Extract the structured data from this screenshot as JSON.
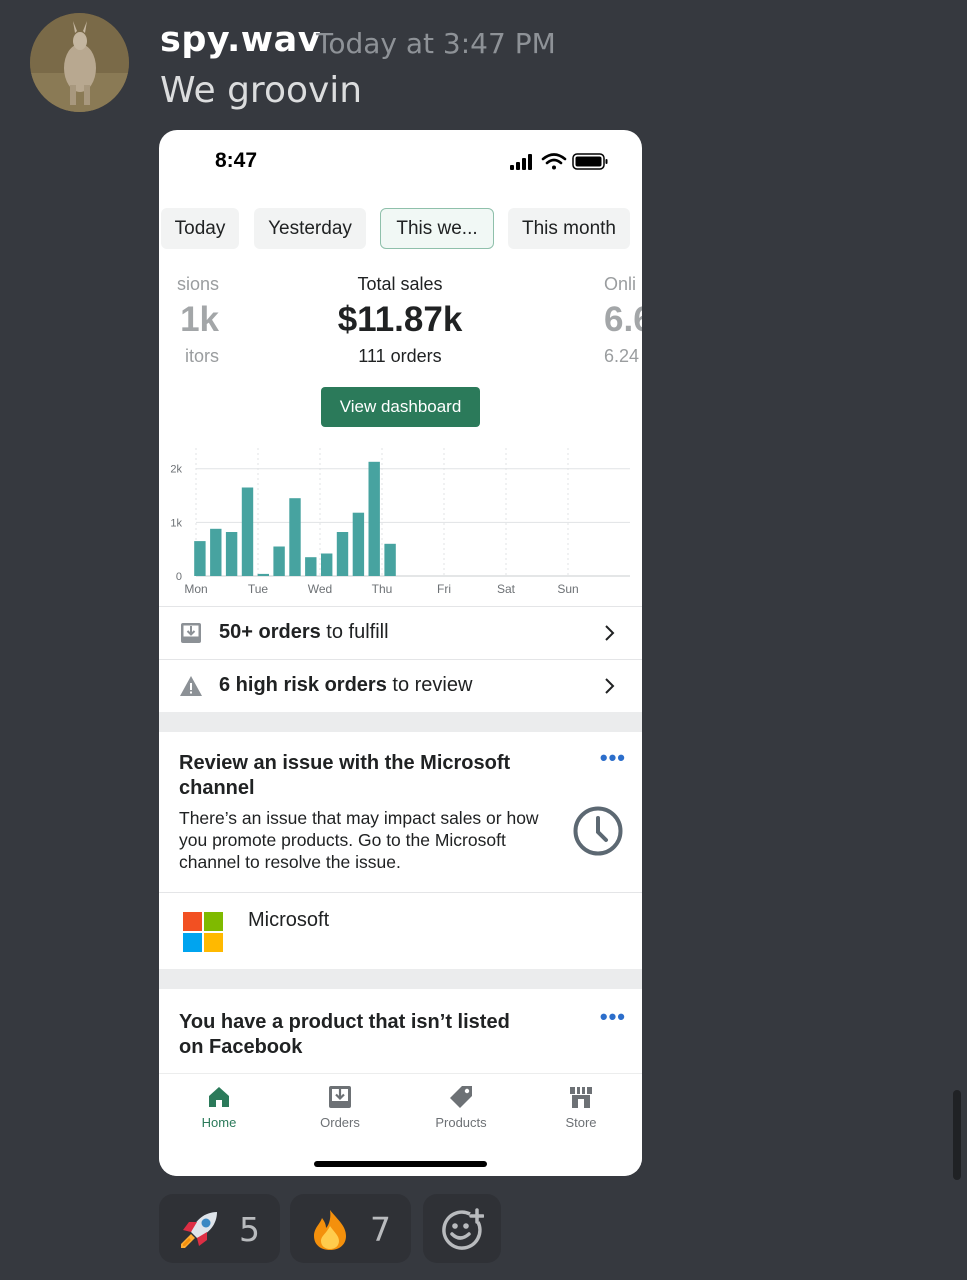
{
  "message": {
    "username": "spy.wav",
    "timestamp": "Today at 3:47 PM",
    "text": "We groovin"
  },
  "phone": {
    "status_time": "8:47",
    "tabs": [
      "Today",
      "Yesterday",
      "This we...",
      "This month"
    ],
    "active_tab": "This we...",
    "stats": {
      "left": {
        "label": "sions",
        "value": "1k",
        "sub": "itors"
      },
      "center": {
        "label": "Total sales",
        "value": "$11.87k",
        "sub": "111 orders"
      },
      "right": {
        "label": "Onli",
        "value": "6.6",
        "sub": "6.24"
      }
    },
    "dashboard_button": "View dashboard",
    "rows": {
      "fulfill": {
        "bold": "50+ orders",
        "rest": " to fulfill"
      },
      "risk": {
        "bold": "6 high risk orders",
        "rest": " to review"
      }
    },
    "card1": {
      "title": "Review an issue with the Microsoft channel",
      "body": "There’s an issue that may impact sales or how you promote products. Go to the Microsoft channel to resolve the issue.",
      "menu": "•••"
    },
    "microsoft_label": "Microsoft",
    "card2": {
      "title": "You have a product that isn’t listed on Facebook",
      "menu": "•••"
    },
    "tabbar": {
      "home": "Home",
      "orders": "Orders",
      "products": "Products",
      "store": "Store"
    }
  },
  "reactions": [
    {
      "emoji": "rocket",
      "count": "5"
    },
    {
      "emoji": "fire",
      "count": "7"
    }
  ],
  "colors": {
    "discord_bg": "#36393f",
    "accent_green": "#2b7a5a",
    "bar_teal": "#47a3a0",
    "link_blue": "#2c6ecb"
  },
  "chart_data": {
    "type": "bar",
    "categories": [
      "Mon",
      "Tue",
      "Wed",
      "Thu",
      "Fri",
      "Sat",
      "Sun"
    ],
    "y_ticks": [
      "0",
      "1k",
      "2k"
    ],
    "ylim": [
      0,
      2200
    ],
    "grid": true,
    "series": [
      {
        "values": [
          650,
          880,
          820,
          1650,
          40,
          550,
          1450,
          350,
          420,
          820,
          1180,
          2130,
          600
        ]
      }
    ]
  }
}
